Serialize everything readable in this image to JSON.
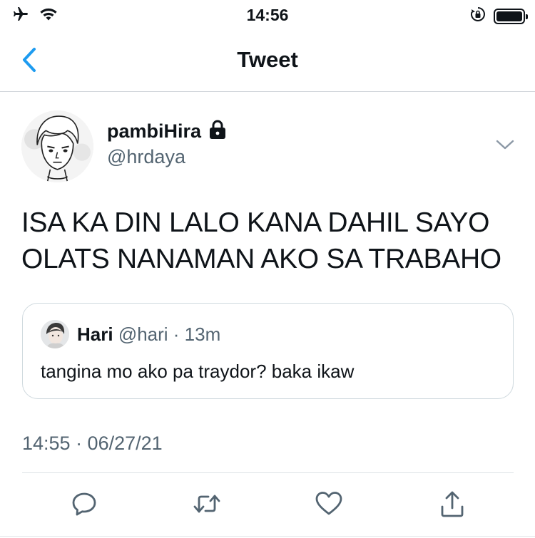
{
  "status_bar": {
    "time": "14:56",
    "icons": [
      "airplane-icon",
      "wifi-icon",
      "orientation-lock-icon",
      "battery-icon"
    ],
    "battery_level": 1.0
  },
  "nav": {
    "title": "Tweet",
    "back_icon": "chevron-left-icon"
  },
  "tweet": {
    "author": {
      "display_name": "pambiHira",
      "handle": "@hrdaya",
      "protected": true
    },
    "text_lines": [
      "ISA KA DIN LALO KANA DAHIL SAYO",
      "OLATS NANAMAN AKO SA TRABAHO"
    ],
    "timestamp": "14:55 · 06/27/21"
  },
  "quoted_tweet": {
    "display_name": "Hari",
    "meta": "@hari · 13m",
    "text": "tangina mo ako pa traydor? baka ikaw"
  },
  "actions": [
    {
      "name": "reply",
      "icon": "reply-icon"
    },
    {
      "name": "retweet",
      "icon": "retweet-icon"
    },
    {
      "name": "like",
      "icon": "heart-icon"
    },
    {
      "name": "share",
      "icon": "share-icon"
    }
  ],
  "colors": {
    "accent": "#1d9bf0",
    "text": "#0f1419",
    "secondary_text": "#536471",
    "border": "#cfd9de"
  }
}
